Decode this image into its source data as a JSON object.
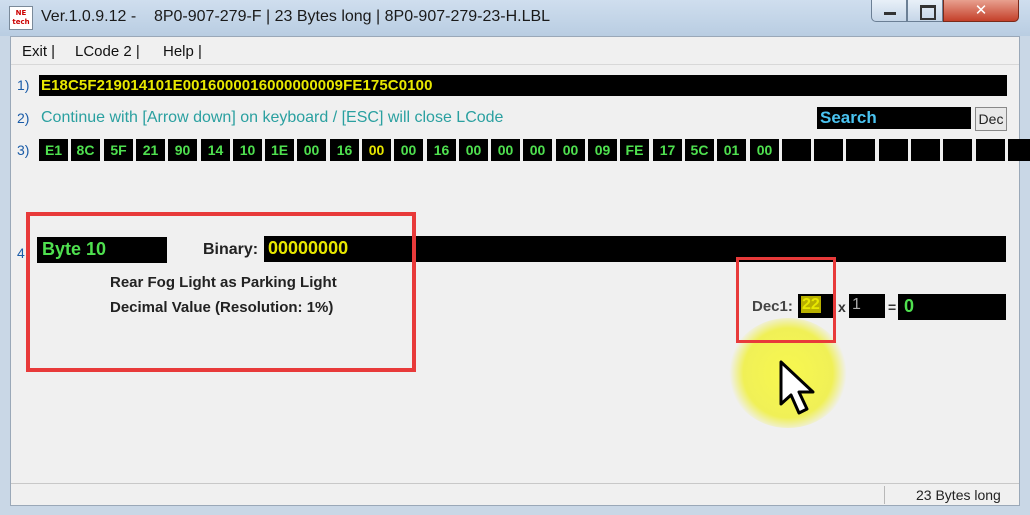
{
  "window": {
    "title": "Ver.1.0.9.12 -    8P0-907-279-F | 23 Bytes long | 8P0-907-279-23-H.LBL",
    "app_icon_text": "NE tech",
    "close_glyph": "✕"
  },
  "menu": {
    "items": [
      "Exit |",
      "LCode 2 |",
      "Help |"
    ]
  },
  "rows": {
    "row1_num": "1)",
    "row2_num": "2)",
    "row3_num": "3)",
    "row4_num": "4"
  },
  "coding": {
    "hex_string": "E18C5F219014101E0016000016000000009FE175C0100"
  },
  "hint": {
    "text": "Continue with [Arrow down] on keyboard / [ESC] will close LCode"
  },
  "search": {
    "label": "Search",
    "dec_button": "Dec"
  },
  "bytes": [
    "E1",
    "8C",
    "5F",
    "21",
    "90",
    "14",
    "10",
    "1E",
    "00",
    "16",
    "00",
    "00",
    "16",
    "00",
    "00",
    "00",
    "00",
    "09",
    "FE",
    "17",
    "5C",
    "01",
    "00",
    "",
    "",
    "",
    "",
    "",
    "",
    "",
    ""
  ],
  "highlighted_byte_index": 10,
  "byte_detail": {
    "label": "Byte 10",
    "binary_label": "Binary:",
    "binary_value": "00000000",
    "description": "Rear Fog Light as Parking Light",
    "decimal_desc": "Decimal Value (Resolution: 1%)"
  },
  "calc": {
    "dec1_label": "Dec1:",
    "dec1_value": "22",
    "multiply": "x",
    "multiplier": "1",
    "equals": "=",
    "result": "0"
  },
  "status": {
    "text": "23 Bytes long"
  },
  "colors": {
    "annotation_red": "#e83a3a",
    "value_yellow": "#e8e800",
    "value_green": "#4fe04f",
    "hint_teal": "#2aa0a0"
  }
}
